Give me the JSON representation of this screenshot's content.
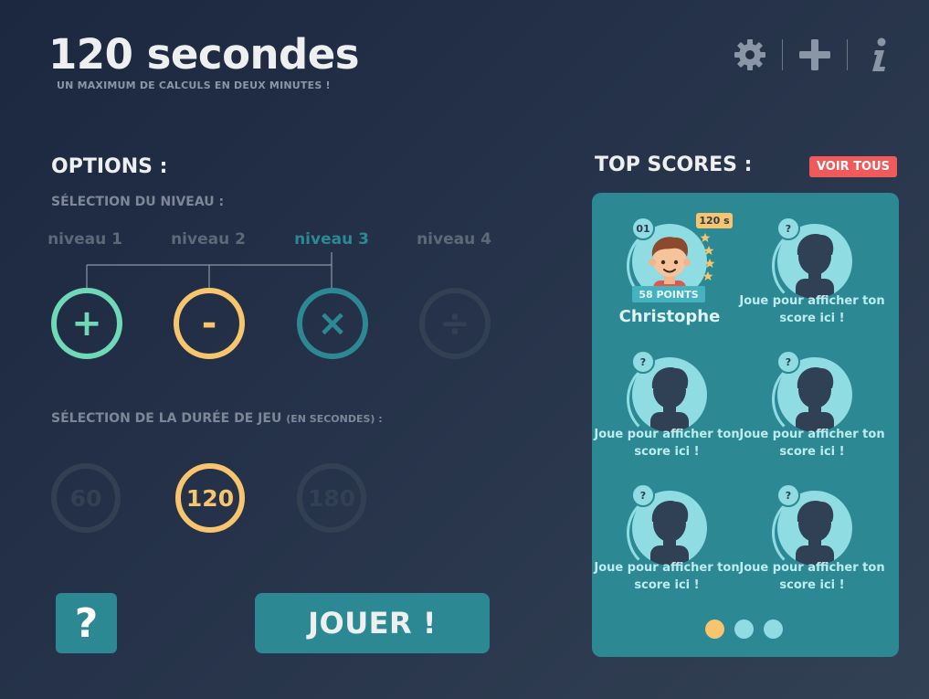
{
  "header": {
    "title": "120 secondes",
    "subtitle": "UN MAXIMUM DE CALCULS EN DEUX MINUTES !",
    "icons": [
      "gear-icon",
      "plus-icon",
      "info-icon"
    ]
  },
  "options": {
    "heading": "OPTIONS :",
    "level_heading": "SÉLECTION DU NIVEAU :",
    "levels": [
      {
        "label": "niveau 1",
        "state": "enabled"
      },
      {
        "label": "niveau 2",
        "state": "enabled"
      },
      {
        "label": "niveau 3",
        "state": "selected"
      },
      {
        "label": "niveau 4",
        "state": "disabled"
      }
    ],
    "operations": [
      {
        "symbol": "+",
        "icon": "plus-circle-icon",
        "color": "#6fd8b7"
      },
      {
        "symbol": "-",
        "icon": "minus-circle-icon",
        "color": "#f6c56d"
      },
      {
        "symbol": "×",
        "icon": "times-circle-icon",
        "color": "#2c8994"
      },
      {
        "symbol": "÷",
        "icon": "divide-circle-icon",
        "color": "#333f52"
      }
    ],
    "duration_heading": "SÉLECTION DE LA DURÉE DE JEU",
    "duration_unit": "(EN SECONDES) :",
    "durations": [
      {
        "value": "60",
        "selected": false
      },
      {
        "value": "120",
        "selected": true
      },
      {
        "value": "180",
        "selected": false
      }
    ]
  },
  "actions": {
    "help_label": "?",
    "play_label": "JOUER !"
  },
  "scores": {
    "heading": "TOP SCORES :",
    "see_all_label": "VOIR TOUS",
    "entries": [
      {
        "rank": "01",
        "name": "Christophe",
        "points": "58 POINTS",
        "duration": "120 s",
        "stars": 4
      },
      {
        "rank": "?",
        "placeholder": "Joue pour afficher ton score ici !"
      },
      {
        "rank": "?",
        "placeholder": "Joue pour afficher ton score ici !"
      },
      {
        "rank": "?",
        "placeholder": "Joue pour afficher ton score ici !"
      },
      {
        "rank": "?",
        "placeholder": "Joue pour afficher ton score ici !"
      },
      {
        "rank": "?",
        "placeholder": "Joue pour afficher ton score ici !"
      }
    ],
    "pages": 3,
    "current_page": 1
  },
  "colors": {
    "accent_teal": "#2c8994",
    "accent_yellow": "#f6c56d",
    "accent_green": "#6fd8b7",
    "button_red": "#f05a5a"
  }
}
